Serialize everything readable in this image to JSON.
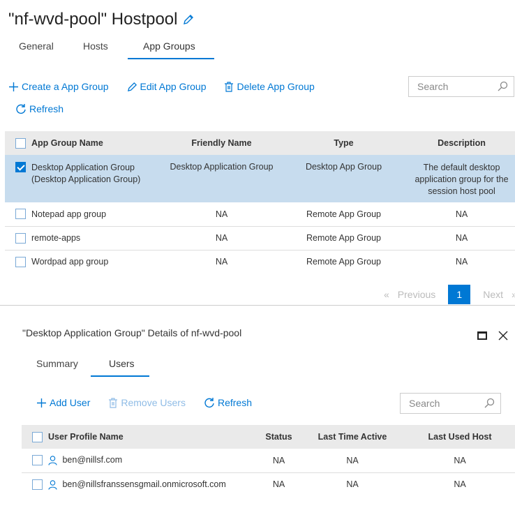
{
  "hostpool": {
    "title": "\"nf-wvd-pool\" Hostpool",
    "tabs": [
      "General",
      "Hosts",
      "App Groups"
    ],
    "active_tab": "App Groups"
  },
  "toolbar": {
    "create_label": "Create a App Group",
    "edit_label": "Edit App Group",
    "delete_label": "Delete App Group",
    "refresh_label": "Refresh",
    "search_placeholder": "Search"
  },
  "app_groups_table": {
    "headers": {
      "name": "App Group Name",
      "friendly": "Friendly Name",
      "type": "Type",
      "description": "Description"
    },
    "rows": [
      {
        "checked": true,
        "name_line1": "Desktop Application Group",
        "name_line2": "(Desktop Application Group)",
        "friendly": "Desktop Application Group",
        "type": "Desktop App Group",
        "desc_line1": "The default desktop",
        "desc_line2": "application group for the",
        "desc_line3": "session host pool"
      },
      {
        "checked": false,
        "name": "Notepad app group",
        "friendly": "NA",
        "type": "Remote App Group",
        "description": "NA"
      },
      {
        "checked": false,
        "name": "remote-apps",
        "friendly": "NA",
        "type": "Remote App Group",
        "description": "NA"
      },
      {
        "checked": false,
        "name": "Wordpad app group",
        "friendly": "NA",
        "type": "Remote App Group",
        "description": "NA"
      }
    ]
  },
  "pagination": {
    "first": "«",
    "previous": "Previous",
    "current": "1",
    "next": "Next",
    "last": "»"
  },
  "details": {
    "title": "\"Desktop Application Group\" Details of nf-wvd-pool",
    "tabs": [
      "Summary",
      "Users"
    ],
    "active_tab": "Users",
    "toolbar": {
      "add_label": "Add User",
      "remove_label": "Remove Users",
      "refresh_label": "Refresh",
      "search_placeholder": "Search"
    },
    "users_table": {
      "headers": {
        "profile": "User Profile Name",
        "status": "Status",
        "last_active": "Last Time Active",
        "last_host": "Last Used Host"
      },
      "rows": [
        {
          "profile": "ben@nillsf.com",
          "status": "NA",
          "last_active": "NA",
          "last_host": "NA"
        },
        {
          "profile": "ben@nillsfranssensgmail.onmicrosoft.com",
          "status": "NA",
          "last_active": "NA",
          "last_host": "NA"
        }
      ]
    }
  },
  "colors": {
    "accent": "#0078d4",
    "selected_row": "#c7dcee",
    "header_bg": "#eaeaea"
  }
}
